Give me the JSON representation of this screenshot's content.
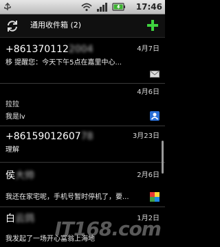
{
  "status_bar": {
    "time": "17:46",
    "icons": [
      "usb-icon",
      "wifi-icon",
      "signal-icon",
      "battery-icon"
    ]
  },
  "header": {
    "title": "通用收件箱 (2)",
    "left_icon": "sync-icon",
    "right_icon": "compose-plus-icon"
  },
  "messages": [
    {
      "sender": "+861370112",
      "sender_obscured": "2004",
      "date": "4月7日",
      "preview": "移 提醒您：今天下午5点在嘉里中心...",
      "icon": "mail-icon"
    },
    {
      "sender": "",
      "date": "4月6日",
      "preview_line1": "拉拉",
      "preview": "我是lv",
      "icon": "contact-app-icon"
    },
    {
      "sender": "+86159012607",
      "sender_obscured": "78",
      "date": "3月23日",
      "preview": "理解",
      "icon": ""
    },
    {
      "sender": "侯",
      "sender_obscured": "大帅",
      "date": "2月6日",
      "preview": "我还在家宅呢，手机号暂时停机了，要...",
      "icon": "colorful-app-icon"
    },
    {
      "sender": "白",
      "sender_obscured": "云鸽",
      "date": "1月2日",
      "preview": "我发起了一场开心富翁上海地",
      "icon": ""
    }
  ],
  "watermark": "IT168.com"
}
